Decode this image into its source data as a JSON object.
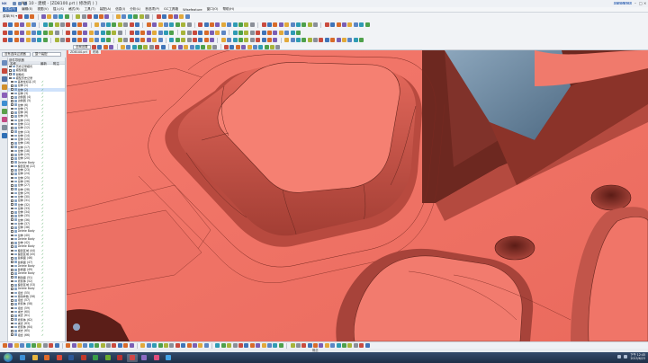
{
  "window": {
    "app_logo": "NX",
    "title": "NX 10 - 建模 - [ZD8100.prt  ( 修改的 ) ]",
    "brand": "SIEMENS"
  },
  "menu": [
    {
      "label": "文件(F)",
      "active": true
    },
    {
      "label": "编辑(E)"
    },
    {
      "label": "视图(V)"
    },
    {
      "label": "插入(S)"
    },
    {
      "label": "格式(R)"
    },
    {
      "label": "工具(T)"
    },
    {
      "label": "装配(A)"
    },
    {
      "label": "信息(I)"
    },
    {
      "label": "分析(L)"
    },
    {
      "label": "首选项(P)"
    },
    {
      "label": "GC工具箱"
    },
    {
      "label": "Wisefeature"
    },
    {
      "label": "窗口(O)"
    },
    {
      "label": "帮助(H)"
    }
  ],
  "toolbar": {
    "menu_button": "菜单(M) ▾",
    "filter_label": "整个装配",
    "snap_combo": "全局设置",
    "select_combo": "没有选择过滤器"
  },
  "navigator": {
    "title": "部件导航器",
    "columns": [
      "名称",
      "最新",
      "附注"
    ],
    "items": [
      {
        "label": "历史记录模式",
        "tick": false
      },
      {
        "label": "模型视图",
        "tick": false
      },
      {
        "label": "摄像机",
        "tick": false
      },
      {
        "label": "模型历史记录",
        "tick": false
      },
      {
        "label": "基准坐标系 (0)",
        "tick": true
      },
      {
        "label": "拉伸 (1)",
        "tick": true
      },
      {
        "label": "拉伸 (2)",
        "tick": true,
        "selected": true
      },
      {
        "label": "拉伸 (3)",
        "tick": true
      },
      {
        "label": "边倒圆 (4)",
        "tick": true
      },
      {
        "label": "边倒圆 (5)",
        "tick": true
      },
      {
        "label": "拉伸 (6)",
        "tick": true
      },
      {
        "label": "拉伸 (7)",
        "tick": true
      },
      {
        "label": "拉伸 (8)",
        "tick": true
      },
      {
        "label": "拉伸 (9)",
        "tick": true
      },
      {
        "label": "拉伸 (10)",
        "tick": true
      },
      {
        "label": "拉伸 (11)",
        "tick": true
      },
      {
        "label": "拉伸 (12)",
        "tick": true
      },
      {
        "label": "拉伸 (13)",
        "tick": true
      },
      {
        "label": "拉伸 (14)",
        "tick": true
      },
      {
        "label": "拉伸 (15)",
        "tick": true
      },
      {
        "label": "拉伸 (16)",
        "tick": true
      },
      {
        "label": "拉伸 (17)",
        "tick": true
      },
      {
        "label": "拉伸 (18)",
        "tick": true
      },
      {
        "label": "拉伸 (19)",
        "tick": true
      },
      {
        "label": "拉伸 (20)",
        "tick": true
      },
      {
        "label": "Delete Body",
        "tick": true
      },
      {
        "label": "偏置区域 (22)",
        "tick": true
      },
      {
        "label": "拉伸 (23)",
        "tick": true
      },
      {
        "label": "拉伸 (24)",
        "tick": true
      },
      {
        "label": "拉伸 (25)",
        "tick": true
      },
      {
        "label": "拉伸 (26)",
        "tick": true
      },
      {
        "label": "拉伸 (27)",
        "tick": true
      },
      {
        "label": "拉伸 (28)",
        "tick": true
      },
      {
        "label": "拉伸 (29)",
        "tick": true
      },
      {
        "label": "拉伸 (30)",
        "tick": true
      },
      {
        "label": "拉伸 (31)",
        "tick": true
      },
      {
        "label": "拉伸 (32)",
        "tick": true
      },
      {
        "label": "拉伸 (33)",
        "tick": true
      },
      {
        "label": "拉伸 (34)",
        "tick": true
      },
      {
        "label": "拉伸 (35)",
        "tick": true
      },
      {
        "label": "拉伸 (36)",
        "tick": true
      },
      {
        "label": "拉伸 (37)",
        "tick": true
      },
      {
        "label": "拉伸 (38)",
        "tick": true
      },
      {
        "label": "Delete Body",
        "tick": true
      },
      {
        "label": "拉伸 (40)",
        "tick": true
      },
      {
        "label": "Delete Body",
        "tick": true
      },
      {
        "label": "拉伸 (42)",
        "tick": true
      },
      {
        "label": "Delete Body",
        "tick": true
      },
      {
        "label": "偏置区域 (44)",
        "tick": true
      },
      {
        "label": "偏置区域 (45)",
        "tick": true
      },
      {
        "label": "替换面 (46)",
        "tick": true
      },
      {
        "label": "替换面 (47)",
        "tick": true
      },
      {
        "label": "Delete Body",
        "tick": true
      },
      {
        "label": "替换面 (49)",
        "tick": true
      },
      {
        "label": "Delete Body",
        "tick": true
      },
      {
        "label": "删除面 (51)",
        "tick": true
      },
      {
        "label": "修剪体 (52)",
        "tick": true
      },
      {
        "label": "偏置区域 (53)",
        "tick": true
      },
      {
        "label": "Delete Body",
        "tick": true
      },
      {
        "label": "组合 (55)",
        "tick": true
      },
      {
        "label": "移除参数 (56)",
        "tick": true
      },
      {
        "label": "组合 (57)",
        "tick": true
      },
      {
        "label": "修剪体 (58)",
        "tick": true
      },
      {
        "label": "组合 (59)",
        "tick": true
      },
      {
        "label": "减去 (60)",
        "tick": true
      },
      {
        "label": "减去 (61)",
        "tick": true
      },
      {
        "label": "修剪体 (62)",
        "tick": true
      },
      {
        "label": "减去 (63)",
        "tick": true
      },
      {
        "label": "修剪体 (64)",
        "tick": true
      },
      {
        "label": "减去 (65)",
        "tick": true
      },
      {
        "label": "组合 (66)",
        "tick": true
      }
    ]
  },
  "viewport": {
    "tabs": [
      "ZD8100.prt",
      "布局"
    ],
    "face_color": "#f07468",
    "shadow_color": "#9c3a31",
    "edge_color": "#5a1e18",
    "steel_color": "#6e8aa2"
  },
  "status": {
    "center_text": "概念"
  },
  "taskbar": {
    "apps": [
      {
        "name": "ie-icon",
        "color": "#3d8fd6"
      },
      {
        "name": "explorer-icon",
        "color": "#e8b640"
      },
      {
        "name": "media-icon",
        "color": "#e06b2a"
      },
      {
        "name": "chrome-icon",
        "color": "#dd4b39"
      },
      {
        "name": "word-icon",
        "color": "#2b5797"
      },
      {
        "name": "pdf-icon",
        "color": "#c0392b"
      },
      {
        "name": "app-icon",
        "color": "#3a9d49"
      },
      {
        "name": "green-app-icon",
        "color": "#6aaa2f"
      },
      {
        "name": "red-app-icon",
        "color": "#b83232"
      },
      {
        "name": "nx-icon",
        "color": "#d04848",
        "active": true
      },
      {
        "name": "paint-icon",
        "color": "#8d6bc2"
      },
      {
        "name": "capture-icon",
        "color": "#e04e7d"
      },
      {
        "name": "chat-icon",
        "color": "#44a4e8"
      }
    ],
    "clock_time": "下午 12:45",
    "clock_date": "2015/6/23"
  }
}
